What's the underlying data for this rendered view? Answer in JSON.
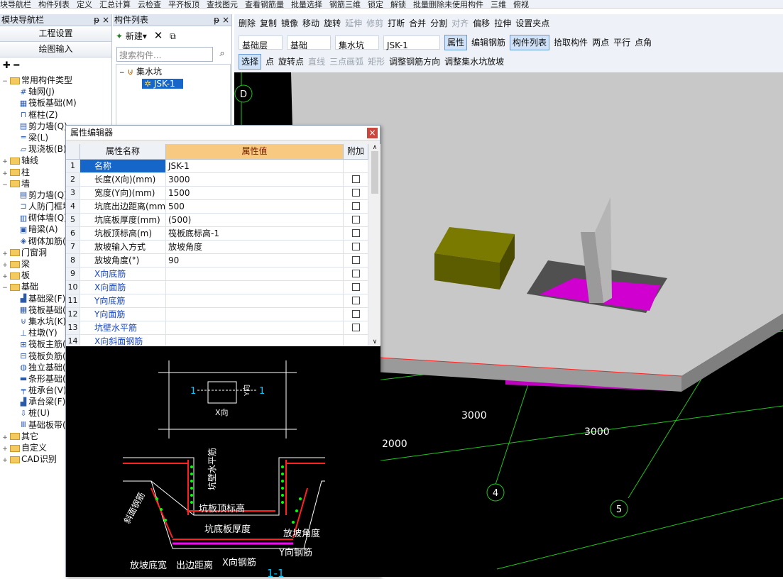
{
  "top_strip": [
    "块导航栏",
    "构件列表",
    "定义",
    "汇总计算",
    "云检查",
    "平齐板顶",
    "查找图元",
    "查看钢筋量",
    "批量选择",
    "钢筋三维",
    "锁定",
    "解锁",
    "批量删除未使用构件",
    "三维",
    "俯视"
  ],
  "nav": {
    "title": "模块导航栏",
    "pin": "ᵽ",
    "close": "×",
    "btn_project": "工程设置",
    "btn_draw": "绘图输入",
    "items": [
      {
        "t": "常用构件类型",
        "lvl": 0,
        "exp": "−",
        "fold": true
      },
      {
        "t": "轴网(J)",
        "lvl": 1,
        "icon": "#"
      },
      {
        "t": "筏板基础(M)",
        "lvl": 1,
        "icon": "▦"
      },
      {
        "t": "框柱(Z)",
        "lvl": 1,
        "icon": "⊓"
      },
      {
        "t": "剪力墙(Q)",
        "lvl": 1,
        "icon": "▤"
      },
      {
        "t": "梁(L)",
        "lvl": 1,
        "icon": "═"
      },
      {
        "t": "现浇板(B)",
        "lvl": 1,
        "icon": "▱"
      },
      {
        "t": "轴线",
        "lvl": 0,
        "exp": "+",
        "fold": true
      },
      {
        "t": "柱",
        "lvl": 0,
        "exp": "+",
        "fold": true
      },
      {
        "t": "墙",
        "lvl": 0,
        "exp": "−",
        "fold": true
      },
      {
        "t": "剪力墙(Q)",
        "lvl": 1,
        "icon": "▤"
      },
      {
        "t": "人防门框墙(RF)",
        "lvl": 1,
        "icon": "⊐"
      },
      {
        "t": "砌体墙(Q)",
        "lvl": 1,
        "icon": "▥"
      },
      {
        "t": "暗梁(A)",
        "lvl": 1,
        "icon": "▣"
      },
      {
        "t": "砌体加筋(Y)",
        "lvl": 1,
        "icon": "◈"
      },
      {
        "t": "门窗洞",
        "lvl": 0,
        "exp": "+",
        "fold": true
      },
      {
        "t": "梁",
        "lvl": 0,
        "exp": "+",
        "fold": true
      },
      {
        "t": "板",
        "lvl": 0,
        "exp": "+",
        "fold": true
      },
      {
        "t": "基础",
        "lvl": 0,
        "exp": "−",
        "fold": true
      },
      {
        "t": "基础梁(F)",
        "lvl": 1,
        "icon": "▟"
      },
      {
        "t": "筏板基础(M)",
        "lvl": 1,
        "icon": "▦"
      },
      {
        "t": "集水坑(K)",
        "lvl": 1,
        "icon": "⊍"
      },
      {
        "t": "柱墩(Y)",
        "lvl": 1,
        "icon": "⊥"
      },
      {
        "t": "筏板主筋(R)",
        "lvl": 1,
        "icon": "⊞"
      },
      {
        "t": "筏板负筋(X)",
        "lvl": 1,
        "icon": "⊟"
      },
      {
        "t": "独立基础(D)",
        "lvl": 1,
        "icon": "◍"
      },
      {
        "t": "条形基础(T)",
        "lvl": 1,
        "icon": "▬"
      },
      {
        "t": "桩承台(V)",
        "lvl": 1,
        "icon": "╤"
      },
      {
        "t": "承台梁(F)",
        "lvl": 1,
        "icon": "▟"
      },
      {
        "t": "桩(U)",
        "lvl": 1,
        "icon": "⇩"
      },
      {
        "t": "基础板带(W)",
        "lvl": 1,
        "icon": "Ⅲ"
      },
      {
        "t": "其它",
        "lvl": 0,
        "exp": "+",
        "fold": true
      },
      {
        "t": "自定义",
        "lvl": 0,
        "exp": "+",
        "fold": true
      },
      {
        "t": "CAD识别",
        "lvl": 0,
        "exp": "+",
        "fold": true
      }
    ]
  },
  "comp": {
    "title": "构件列表",
    "pin": "ᵽ",
    "close": "×",
    "new_label": "新建",
    "search_placeholder": "搜索构件...",
    "tree_root": "集水坑",
    "tree_child": "JSK-1"
  },
  "toolbar": {
    "row1": [
      "删除",
      "复制",
      "镜像",
      "移动",
      "旋转",
      "延伸",
      "修剪",
      "打断",
      "合并",
      "分割",
      "对齐",
      "偏移",
      "拉伸",
      "设置夹点"
    ],
    "row2_sel": [
      "基础层",
      "基础",
      "集水坑",
      "JSK-1"
    ],
    "row2_btn": [
      "属性",
      "编辑钢筋",
      "构件列表",
      "拾取构件"
    ],
    "row2_right": [
      "两点",
      "平行",
      "点角"
    ],
    "row3": [
      "选择",
      "点",
      "旋转点",
      "直线",
      "三点画弧",
      "矩形",
      "调整钢筋方向",
      "调整集水坑放坡"
    ]
  },
  "view": {
    "axis_d": "D",
    "axis_4": "4",
    "axis_5": "5",
    "dim_3000a": "3000",
    "dim_3000b": "3000",
    "dim_2000": "2000"
  },
  "dialog": {
    "title": "属性编辑器",
    "close": "×",
    "headers": [
      "属性名称",
      "属性值",
      "附加"
    ],
    "rows": [
      {
        "n": "1",
        "name": "名称",
        "val": "JSK-1",
        "chk": false,
        "sel": true
      },
      {
        "n": "2",
        "name": "长度(X向)(mm)",
        "val": "3000",
        "chk": true
      },
      {
        "n": "3",
        "name": "宽度(Y向)(mm)",
        "val": "1500",
        "chk": true
      },
      {
        "n": "4",
        "name": "坑底出边距离(mm)",
        "val": "500",
        "chk": true
      },
      {
        "n": "5",
        "name": "坑底板厚度(mm)",
        "val": "(500)",
        "chk": true
      },
      {
        "n": "6",
        "name": "坑板顶标高(m)",
        "val": "筏板底标高-1",
        "chk": true
      },
      {
        "n": "7",
        "name": "放坡输入方式",
        "val": "放坡角度",
        "chk": true
      },
      {
        "n": "8",
        "name": "放坡角度(°)",
        "val": "90",
        "chk": true
      },
      {
        "n": "9",
        "name": "X向底筋",
        "val": "",
        "chk": true,
        "blue": true
      },
      {
        "n": "10",
        "name": "X向面筋",
        "val": "",
        "chk": true,
        "blue": true
      },
      {
        "n": "11",
        "name": "Y向底筋",
        "val": "",
        "chk": true,
        "blue": true
      },
      {
        "n": "12",
        "name": "Y向面筋",
        "val": "",
        "chk": true,
        "blue": true
      },
      {
        "n": "13",
        "name": "坑壁水平筋",
        "val": "",
        "chk": true,
        "blue": true
      },
      {
        "n": "14",
        "name": "X向斜面钢筋",
        "val": "",
        "chk": false,
        "blue": true
      }
    ]
  },
  "cad": {
    "mark1": "1",
    "mark2": "1",
    "x_label": "X向",
    "y_label": "Y向",
    "wall_h": "坑壁水平筋",
    "top_elev": "坑板顶标高",
    "bottom_thk": "坑底板厚度",
    "slope_angle": "放坡角度",
    "y_bar": "Y向钢筋",
    "x_bar": "X向钢筋",
    "slope_bar": "斜面钢筋",
    "slope_width": "放坡底宽",
    "edge_dist": "出边距离",
    "section": "1-1"
  }
}
